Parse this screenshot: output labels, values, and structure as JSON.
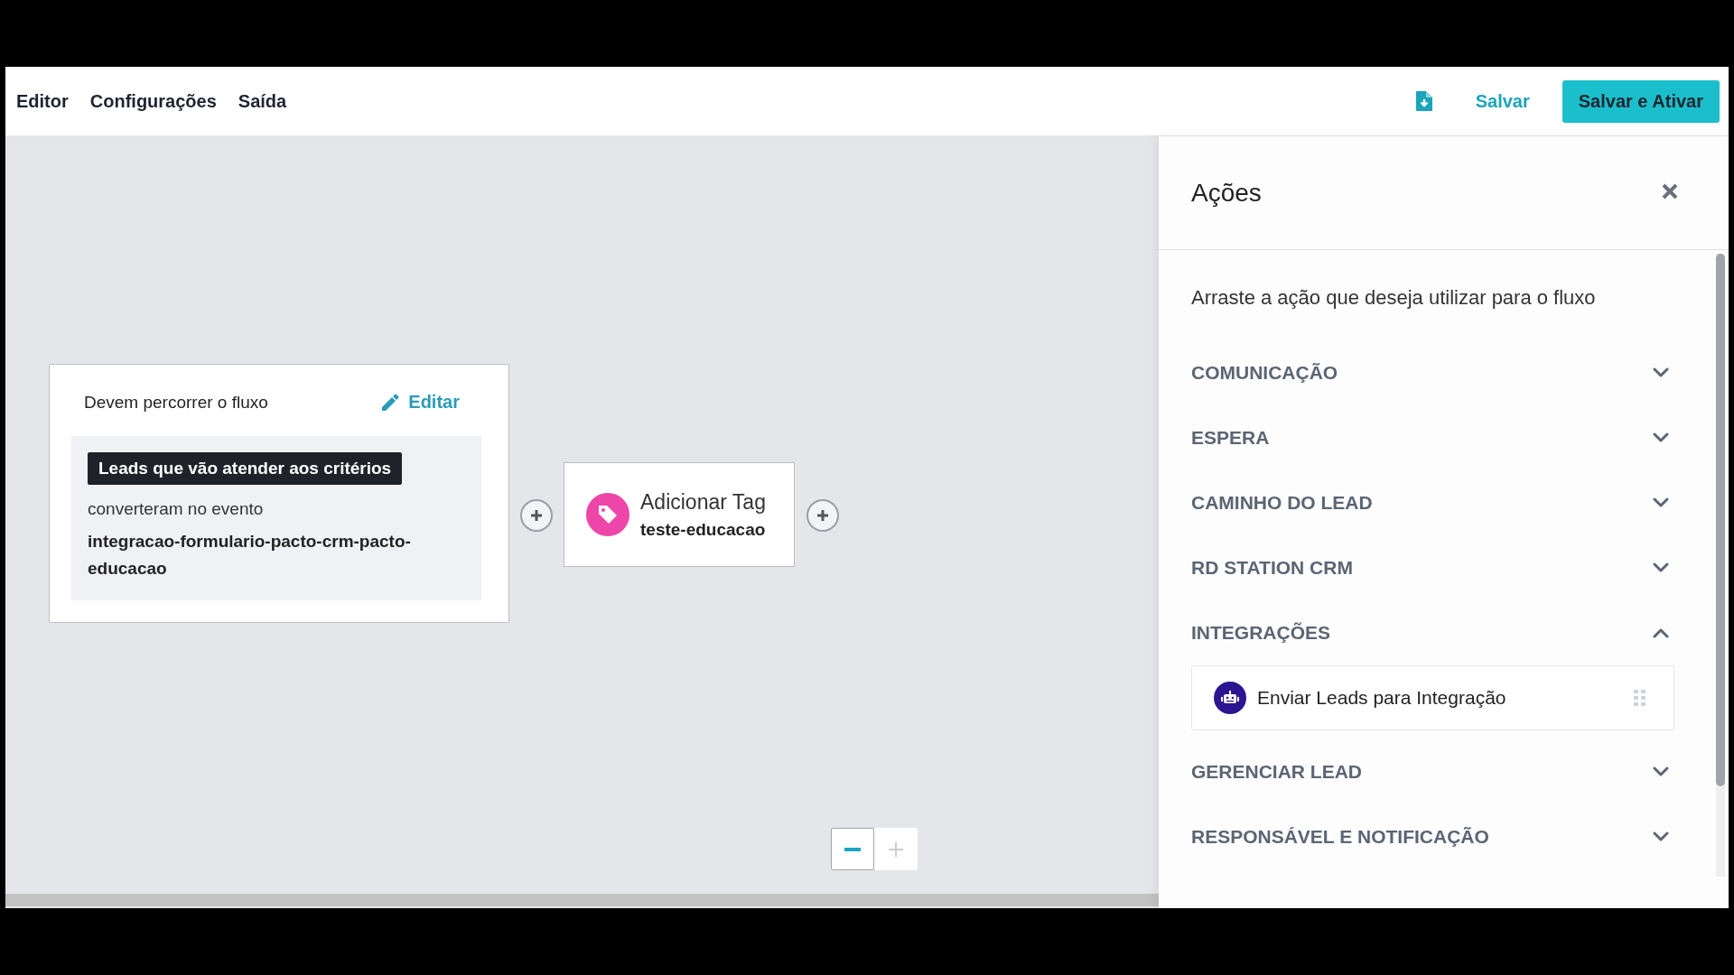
{
  "header": {
    "menu": [
      {
        "label": "Editor"
      },
      {
        "label": "Configurações"
      },
      {
        "label": "Saída"
      }
    ],
    "save_label": "Salvar",
    "save_activate_label": "Salvar e Ativar"
  },
  "canvas": {
    "trigger": {
      "title": "Devem percorrer o fluxo",
      "edit_label": "Editar",
      "criteria_badge": "Leads que vão atender aos critérios",
      "condition": "converteram no evento",
      "event": "integracao-formulario-pacto-crm-pacto-educacao"
    },
    "action_node": {
      "title": "Adicionar Tag",
      "value": "teste-educacao"
    },
    "zoom": [
      {
        "kind": "minus",
        "disabled": false
      },
      {
        "kind": "plus",
        "disabled": true
      }
    ]
  },
  "panel": {
    "title": "Ações",
    "description": "Arraste a ação que deseja utilizar para o fluxo",
    "categories": [
      {
        "label": "COMUNICAÇÃO",
        "expanded": false
      },
      {
        "label": "ESPERA",
        "expanded": false
      },
      {
        "label": "CAMINHO DO LEAD",
        "expanded": false
      },
      {
        "label": "RD STATION CRM",
        "expanded": false
      },
      {
        "label": "INTEGRAÇÕES",
        "expanded": true,
        "items": [
          {
            "label": "Enviar Leads para Integração"
          }
        ]
      },
      {
        "label": "GERENCIAR LEAD",
        "expanded": false
      },
      {
        "label": "RESPONSÁVEL E NOTIFICAÇÃO",
        "expanded": false
      }
    ]
  }
}
